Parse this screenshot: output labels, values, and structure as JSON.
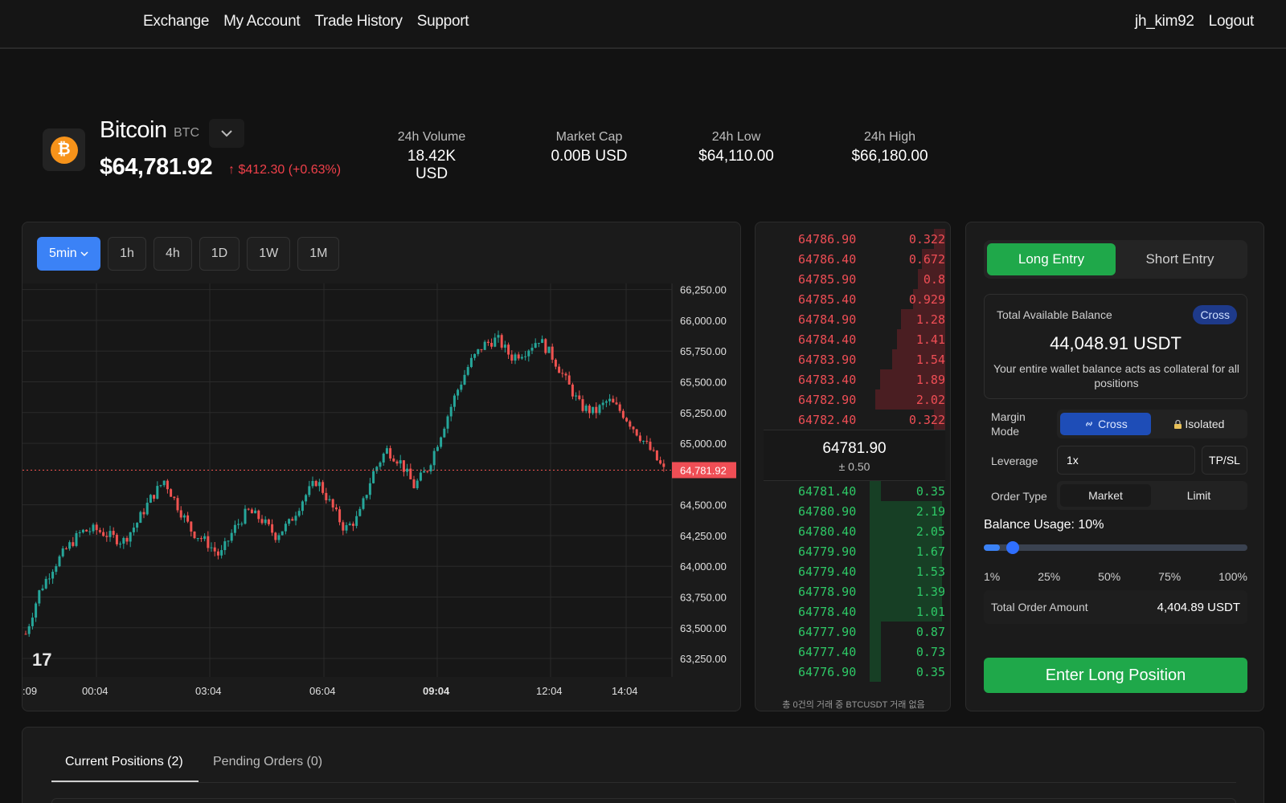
{
  "nav": {
    "links": [
      "Exchange",
      "My Account",
      "Trade History",
      "Support"
    ],
    "username": "jh_kim92",
    "logout": "Logout"
  },
  "ticker": {
    "name": "Bitcoin",
    "symbol": "BTC",
    "price": "$64,781.92",
    "change": "↑ $412.30 (+0.63%)",
    "stats": [
      {
        "label": "24h Volume",
        "value": "18.42K USD"
      },
      {
        "label": "Market Cap",
        "value": "0.00B USD"
      },
      {
        "label": "24h Low",
        "value": "$64,110.00"
      },
      {
        "label": "24h High",
        "value": "$66,180.00"
      }
    ]
  },
  "timeframes": [
    "5min",
    "1h",
    "4h",
    "1D",
    "1W",
    "1M"
  ],
  "active_timeframe": "5min",
  "chart_data": {
    "type": "candlestick",
    "y_ticks": [
      "66,250.00",
      "66,000.00",
      "65,750.00",
      "65,500.00",
      "65,250.00",
      "65,000.00",
      "64,500.00",
      "64,250.00",
      "64,000.00",
      "63,750.00",
      "63,500.00",
      "63,250.00"
    ],
    "x_ticks": [
      ":09",
      "00:04",
      "03:04",
      "06:04",
      "09:04",
      "12:04",
      "14:04"
    ],
    "current_price_label": "64,781.92",
    "current_price": 64781.92,
    "ylim": [
      63100,
      66300
    ],
    "approx_close_path": [
      63450,
      63800,
      64000,
      64150,
      64280,
      64300,
      64250,
      64200,
      64350,
      64550,
      64700,
      64480,
      64280,
      64200,
      64080,
      64300,
      64450,
      64380,
      64250,
      64350,
      64550,
      64700,
      64500,
      64300,
      64400,
      64750,
      64950,
      64850,
      64650,
      64800,
      65100,
      65400,
      65650,
      65800,
      65850,
      65700,
      65750,
      65850,
      65700,
      65500,
      65300,
      65250,
      65350,
      65250,
      65100,
      64950,
      64781.92
    ]
  },
  "order_book": {
    "asks": [
      {
        "price": "64786.90",
        "qty": "0.322"
      },
      {
        "price": "64786.40",
        "qty": "0.672"
      },
      {
        "price": "64785.90",
        "qty": "0.8"
      },
      {
        "price": "64785.40",
        "qty": "0.929"
      },
      {
        "price": "64784.90",
        "qty": "1.28"
      },
      {
        "price": "64784.40",
        "qty": "1.41"
      },
      {
        "price": "64783.90",
        "qty": "1.54"
      },
      {
        "price": "64783.40",
        "qty": "1.89"
      },
      {
        "price": "64782.90",
        "qty": "2.02"
      },
      {
        "price": "64782.40",
        "qty": "0.322"
      }
    ],
    "mid_price": "64781.90",
    "spread": "± 0.50",
    "bids": [
      {
        "price": "64781.40",
        "qty": "0.35"
      },
      {
        "price": "64780.90",
        "qty": "2.19"
      },
      {
        "price": "64780.40",
        "qty": "2.05"
      },
      {
        "price": "64779.90",
        "qty": "1.67"
      },
      {
        "price": "64779.40",
        "qty": "1.53"
      },
      {
        "price": "64778.90",
        "qty": "1.39"
      },
      {
        "price": "64778.40",
        "qty": "1.01"
      },
      {
        "price": "64777.90",
        "qty": "0.87"
      },
      {
        "price": "64777.40",
        "qty": "0.73"
      },
      {
        "price": "64776.90",
        "qty": "0.35"
      }
    ],
    "footer": "총 0건의 거래 중 BTCUSDT 거래 없음"
  },
  "order_form": {
    "long_label": "Long Entry",
    "short_label": "Short Entry",
    "balance_label": "Total Available Balance",
    "balance_badge": "Cross",
    "balance_amount": "44,048.91 USDT",
    "balance_desc": "Your entire wallet balance acts as collateral for all positions",
    "margin_mode_label": "Margin Mode",
    "margin_cross": "Cross",
    "margin_isolated": "Isolated",
    "leverage_label": "Leverage",
    "leverage_value": "1x",
    "tpsl_label": "TP/SL",
    "order_type_label": "Order Type",
    "order_market": "Market",
    "order_limit": "Limit",
    "usage_label": "Balance Usage: 10%",
    "usage_fraction": 0.1,
    "usage_ticks": [
      "1%",
      "25%",
      "50%",
      "75%",
      "100%"
    ],
    "total_label": "Total Order Amount",
    "total_value": "4,404.89 USDT",
    "submit_label": "Enter Long Position"
  },
  "bottom_tabs": {
    "positions": "Current Positions (2)",
    "pending": "Pending Orders (0)"
  },
  "colors": {
    "accent_blue": "#3b82f6",
    "up_green": "#1fa84a",
    "down_red": "#ef4e55"
  }
}
